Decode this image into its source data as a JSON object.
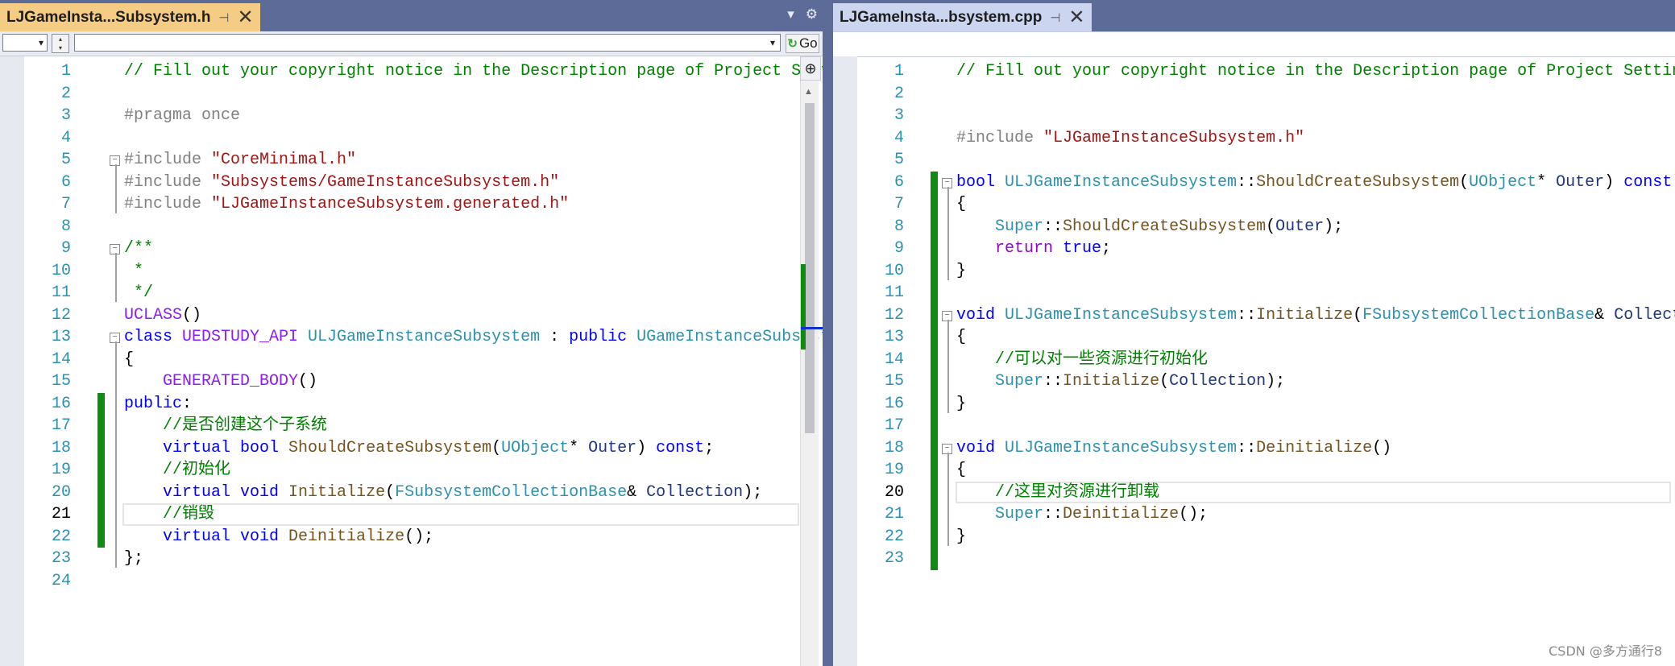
{
  "left_pane": {
    "tab_title": "LJGameInsta...Subsystem.h",
    "pin_icon": "pin-icon",
    "close_icon": "close-icon",
    "navbar": {
      "scope_combo": "",
      "member_combo": "",
      "go_label": "Go"
    },
    "lines": [
      {
        "n": "1",
        "tokens": [
          {
            "t": "// Fill out your copyright notice in the Description page of Project Settings.",
            "c": "cm"
          }
        ]
      },
      {
        "n": "2",
        "tokens": []
      },
      {
        "n": "3",
        "tokens": [
          {
            "t": "#pragma once",
            "c": "pp"
          }
        ]
      },
      {
        "n": "4",
        "tokens": []
      },
      {
        "n": "5",
        "tokens": [
          {
            "t": "#include ",
            "c": "pp"
          },
          {
            "t": "\"CoreMinimal.h\"",
            "c": "st"
          }
        ]
      },
      {
        "n": "6",
        "tokens": [
          {
            "t": "#include ",
            "c": "pp"
          },
          {
            "t": "\"Subsystems/GameInstanceSubsystem.h\"",
            "c": "st"
          }
        ]
      },
      {
        "n": "7",
        "tokens": [
          {
            "t": "#include ",
            "c": "pp"
          },
          {
            "t": "\"LJGameInstanceSubsystem.generated.h\"",
            "c": "st"
          }
        ]
      },
      {
        "n": "8",
        "tokens": []
      },
      {
        "n": "9",
        "tokens": [
          {
            "t": "/**",
            "c": "cm"
          }
        ]
      },
      {
        "n": "10",
        "tokens": [
          {
            "t": " *",
            "c": "cm"
          }
        ]
      },
      {
        "n": "11",
        "tokens": [
          {
            "t": " */",
            "c": "cm"
          }
        ]
      },
      {
        "n": "12",
        "tokens": [
          {
            "t": "UCLASS",
            "c": "mc"
          },
          {
            "t": "()",
            "c": "tx"
          }
        ]
      },
      {
        "n": "13",
        "tokens": [
          {
            "t": "class ",
            "c": "kw"
          },
          {
            "t": "UEDSTUDY_API ",
            "c": "mc"
          },
          {
            "t": "ULJGameInstanceSubsystem",
            "c": "ty"
          },
          {
            "t": " : ",
            "c": "tx"
          },
          {
            "t": "public ",
            "c": "kw"
          },
          {
            "t": "UGameInstanceSubsystem",
            "c": "ty"
          }
        ]
      },
      {
        "n": "14",
        "tokens": [
          {
            "t": "{",
            "c": "tx"
          }
        ]
      },
      {
        "n": "15",
        "tokens": [
          {
            "t": "    ",
            "c": "tx"
          },
          {
            "t": "GENERATED_BODY",
            "c": "mc"
          },
          {
            "t": "()",
            "c": "tx"
          }
        ]
      },
      {
        "n": "16",
        "tokens": [
          {
            "t": "public",
            "c": "kw"
          },
          {
            "t": ":",
            "c": "tx"
          }
        ]
      },
      {
        "n": "17",
        "tokens": [
          {
            "t": "    //是否创建这个子系统",
            "c": "cm"
          }
        ]
      },
      {
        "n": "18",
        "tokens": [
          {
            "t": "    ",
            "c": "tx"
          },
          {
            "t": "virtual ",
            "c": "kw"
          },
          {
            "t": "bool ",
            "c": "kw"
          },
          {
            "t": "ShouldCreateSubsystem",
            "c": "fn"
          },
          {
            "t": "(",
            "c": "tx"
          },
          {
            "t": "UObject",
            "c": "ty"
          },
          {
            "t": "* ",
            "c": "tx"
          },
          {
            "t": "Outer",
            "c": "pr"
          },
          {
            "t": ") ",
            "c": "tx"
          },
          {
            "t": "const",
            "c": "kw"
          },
          {
            "t": ";",
            "c": "tx"
          }
        ]
      },
      {
        "n": "19",
        "tokens": [
          {
            "t": "    //初始化",
            "c": "cm"
          }
        ]
      },
      {
        "n": "20",
        "tokens": [
          {
            "t": "    ",
            "c": "tx"
          },
          {
            "t": "virtual ",
            "c": "kw"
          },
          {
            "t": "void ",
            "c": "kw"
          },
          {
            "t": "Initialize",
            "c": "fn"
          },
          {
            "t": "(",
            "c": "tx"
          },
          {
            "t": "FSubsystemCollectionBase",
            "c": "ty"
          },
          {
            "t": "& ",
            "c": "tx"
          },
          {
            "t": "Collection",
            "c": "pr"
          },
          {
            "t": ");",
            "c": "tx"
          }
        ]
      },
      {
        "n": "21",
        "tokens": [
          {
            "t": "    //销毁",
            "c": "cm"
          }
        ]
      },
      {
        "n": "22",
        "tokens": [
          {
            "t": "    ",
            "c": "tx"
          },
          {
            "t": "virtual ",
            "c": "kw"
          },
          {
            "t": "void ",
            "c": "kw"
          },
          {
            "t": "Deinitialize",
            "c": "fn"
          },
          {
            "t": "();",
            "c": "tx"
          }
        ]
      },
      {
        "n": "23",
        "tokens": [
          {
            "t": "};",
            "c": "tx"
          }
        ]
      },
      {
        "n": "24",
        "tokens": []
      }
    ]
  },
  "right_pane": {
    "tab_title": "LJGameInsta...bsystem.cpp",
    "pin_icon": "pin-icon",
    "close_icon": "close-icon",
    "lines": [
      {
        "n": "1",
        "tokens": [
          {
            "t": "// Fill out your copyright notice in the Description page of Project Settings.",
            "c": "cm"
          }
        ]
      },
      {
        "n": "2",
        "tokens": []
      },
      {
        "n": "3",
        "tokens": []
      },
      {
        "n": "4",
        "tokens": [
          {
            "t": "#include ",
            "c": "pp"
          },
          {
            "t": "\"LJGameInstanceSubsystem.h\"",
            "c": "st"
          }
        ]
      },
      {
        "n": "5",
        "tokens": []
      },
      {
        "n": "6",
        "tokens": [
          {
            "t": "bool ",
            "c": "kw"
          },
          {
            "t": "ULJGameInstanceSubsystem",
            "c": "ty"
          },
          {
            "t": "::",
            "c": "tx"
          },
          {
            "t": "ShouldCreateSubsystem",
            "c": "fn"
          },
          {
            "t": "(",
            "c": "tx"
          },
          {
            "t": "UObject",
            "c": "ty"
          },
          {
            "t": "* ",
            "c": "tx"
          },
          {
            "t": "Outer",
            "c": "pr"
          },
          {
            "t": ") ",
            "c": "tx"
          },
          {
            "t": "const",
            "c": "kw"
          }
        ]
      },
      {
        "n": "7",
        "tokens": [
          {
            "t": "{",
            "c": "tx"
          }
        ]
      },
      {
        "n": "8",
        "tokens": [
          {
            "t": "    ",
            "c": "tx"
          },
          {
            "t": "Super",
            "c": "ty"
          },
          {
            "t": "::",
            "c": "tx"
          },
          {
            "t": "ShouldCreateSubsystem",
            "c": "fn"
          },
          {
            "t": "(",
            "c": "tx"
          },
          {
            "t": "Outer",
            "c": "pr"
          },
          {
            "t": ");",
            "c": "tx"
          }
        ]
      },
      {
        "n": "9",
        "tokens": [
          {
            "t": "    ",
            "c": "tx"
          },
          {
            "t": "return ",
            "c": "kw2"
          },
          {
            "t": "true",
            "c": "kw"
          },
          {
            "t": ";",
            "c": "tx"
          }
        ]
      },
      {
        "n": "10",
        "tokens": [
          {
            "t": "}",
            "c": "tx"
          }
        ]
      },
      {
        "n": "11",
        "tokens": []
      },
      {
        "n": "12",
        "tokens": [
          {
            "t": "void ",
            "c": "kw"
          },
          {
            "t": "ULJGameInstanceSubsystem",
            "c": "ty"
          },
          {
            "t": "::",
            "c": "tx"
          },
          {
            "t": "Initialize",
            "c": "fn"
          },
          {
            "t": "(",
            "c": "tx"
          },
          {
            "t": "FSubsystemCollectionBase",
            "c": "ty"
          },
          {
            "t": "& ",
            "c": "tx"
          },
          {
            "t": "Collection",
            "c": "pr"
          },
          {
            "t": ")",
            "c": "tx"
          }
        ]
      },
      {
        "n": "13",
        "tokens": [
          {
            "t": "{",
            "c": "tx"
          }
        ]
      },
      {
        "n": "14",
        "tokens": [
          {
            "t": "    //可以对一些资源进行初始化",
            "c": "cm"
          }
        ]
      },
      {
        "n": "15",
        "tokens": [
          {
            "t": "    ",
            "c": "tx"
          },
          {
            "t": "Super",
            "c": "ty"
          },
          {
            "t": "::",
            "c": "tx"
          },
          {
            "t": "Initialize",
            "c": "fn"
          },
          {
            "t": "(",
            "c": "tx"
          },
          {
            "t": "Collection",
            "c": "pr"
          },
          {
            "t": ");",
            "c": "tx"
          }
        ]
      },
      {
        "n": "16",
        "tokens": [
          {
            "t": "}",
            "c": "tx"
          }
        ]
      },
      {
        "n": "17",
        "tokens": []
      },
      {
        "n": "18",
        "tokens": [
          {
            "t": "void ",
            "c": "kw"
          },
          {
            "t": "ULJGameInstanceSubsystem",
            "c": "ty"
          },
          {
            "t": "::",
            "c": "tx"
          },
          {
            "t": "Deinitialize",
            "c": "fn"
          },
          {
            "t": "()",
            "c": "tx"
          }
        ]
      },
      {
        "n": "19",
        "tokens": [
          {
            "t": "{",
            "c": "tx"
          }
        ]
      },
      {
        "n": "20",
        "tokens": [
          {
            "t": "    //这里对资源进行卸载",
            "c": "cm"
          }
        ]
      },
      {
        "n": "21",
        "tokens": [
          {
            "t": "    ",
            "c": "tx"
          },
          {
            "t": "Super",
            "c": "ty"
          },
          {
            "t": "::",
            "c": "tx"
          },
          {
            "t": "Deinitialize",
            "c": "fn"
          },
          {
            "t": "();",
            "c": "tx"
          }
        ]
      },
      {
        "n": "22",
        "tokens": [
          {
            "t": "}",
            "c": "tx"
          }
        ]
      },
      {
        "n": "23",
        "tokens": []
      }
    ]
  },
  "toolbar_icons": [
    "dropdown-arrow-icon",
    "gear-icon"
  ],
  "watermark": "CSDN @多方通行8",
  "colors": {
    "tab_active": "#f5cc84",
    "tab_inactive": "#ccd5f0",
    "chrome": "#5d6b99",
    "comment": "#008000",
    "keyword": "#0000ff",
    "type": "#2b91af",
    "string": "#a31515",
    "change_bar": "#108a10"
  }
}
